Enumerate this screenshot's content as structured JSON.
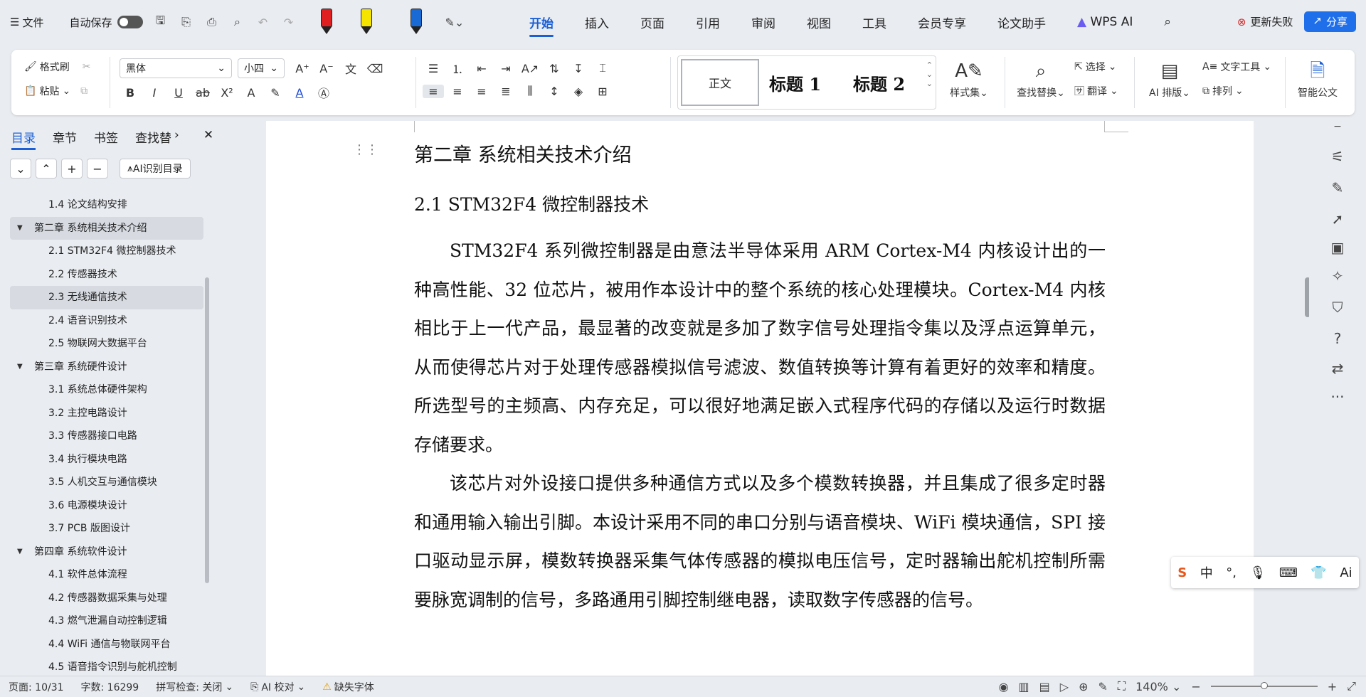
{
  "menubar": {
    "menu_label": "文件",
    "autosave_label": "自动保存",
    "tabs": [
      "开始",
      "插入",
      "页面",
      "引用",
      "审阅",
      "视图",
      "工具",
      "会员专享",
      "论文助手",
      "WPS AI"
    ],
    "active_tab": "开始",
    "update_failed": "更新失败",
    "share": "分享"
  },
  "ribbon": {
    "format_painter": "格式刷",
    "paste": "粘贴",
    "font_name": "黑体",
    "font_size": "小四",
    "styles": {
      "normal": "正文",
      "heading1": "标题 1",
      "heading2": "标题 2"
    },
    "style_set": "样式集",
    "find_replace": "查找替换",
    "select": "选择",
    "translate": "翻译",
    "ai_layout": "AI 排版",
    "text_tools": "文字工具",
    "arrange": "排列",
    "smart_doc": "智能公文"
  },
  "leftpanel": {
    "tabs": [
      "目录",
      "章节",
      "书签",
      "查找替"
    ],
    "active_tab": "目录",
    "ai_toc": "AI识别目录",
    "toc": [
      {
        "level": 2,
        "text": "1.4 论文结构安排",
        "hl": false
      },
      {
        "level": 1,
        "text": "第二章 系统相关技术介绍",
        "hl": true
      },
      {
        "level": 2,
        "text": "2.1 STM32F4 微控制器技术",
        "hl": false
      },
      {
        "level": 2,
        "text": "2.2 传感器技术",
        "hl": false
      },
      {
        "level": 2,
        "text": "2.3 无线通信技术",
        "hl": true
      },
      {
        "level": 2,
        "text": "2.4 语音识别技术",
        "hl": false
      },
      {
        "level": 2,
        "text": "2.5 物联网大数据平台",
        "hl": false
      },
      {
        "level": 1,
        "text": "第三章 系统硬件设计",
        "hl": false
      },
      {
        "level": 2,
        "text": "3.1 系统总体硬件架构",
        "hl": false
      },
      {
        "level": 2,
        "text": "3.2 主控电路设计",
        "hl": false
      },
      {
        "level": 2,
        "text": "3.3 传感器接口电路",
        "hl": false
      },
      {
        "level": 2,
        "text": "3.4 执行模块电路",
        "hl": false
      },
      {
        "level": 2,
        "text": "3.5 人机交互与通信模块",
        "hl": false
      },
      {
        "level": 2,
        "text": "3.6 电源模块设计",
        "hl": false
      },
      {
        "level": 2,
        "text": "3.7 PCB 版图设计",
        "hl": false
      },
      {
        "level": 1,
        "text": "第四章 系统软件设计",
        "hl": false
      },
      {
        "level": 2,
        "text": "4.1 软件总体流程",
        "hl": false
      },
      {
        "level": 2,
        "text": "4.2 传感器数据采集与处理",
        "hl": false
      },
      {
        "level": 2,
        "text": "4.3 燃气泄漏自动控制逻辑",
        "hl": false
      },
      {
        "level": 2,
        "text": "4.4 WiFi 通信与物联网平台",
        "hl": false
      },
      {
        "level": 2,
        "text": "4.5 语音指令识别与舵机控制",
        "hl": false
      }
    ]
  },
  "document": {
    "chapter_title": "第二章  系统相关技术介绍",
    "section_title": "2.1 STM32F4 微控制器技术",
    "paragraphs": [
      "STM32F4 系列微控制器是由意法半导体采用 ARM Cortex-M4 内核设计出的一种高性能、32 位芯片，被用作本设计中的整个系统的核心处理模块。Cortex-M4 内核相比于上一代产品，最显著的改变就是多加了数字信号处理指令集以及浮点运算单元，从而使得芯片对于处理传感器模拟信号滤波、数值转换等计算有着更好的效率和精度。所选型号的主频高、内存充足，可以很好地满足嵌入式程序代码的存储以及运行时数据存储要求。",
      "该芯片对外设接口提供多种通信方式以及多个模数转换器，并且集成了很多定时器和通用输入输出引脚。本设计采用不同的串口分别与语音模块、WiFi 模块通信，SPI 接口驱动显示屏，模数转换器采集气体传感器的模拟电压信号，定时器输出舵机控制所需要脉宽调制的信号，多路通用引脚控制继电器，读取数字传感器的信号。"
    ]
  },
  "statusbar": {
    "page": "页面: 10/31",
    "words": "字数: 16299",
    "spellcheck": "拼写检查: 关闭",
    "ai_proof": "AI 校对",
    "missing_font": "缺失字体",
    "zoom": "140%"
  },
  "colors": {
    "accent": "#1a5fd6",
    "share_bg": "#1f6fea"
  }
}
